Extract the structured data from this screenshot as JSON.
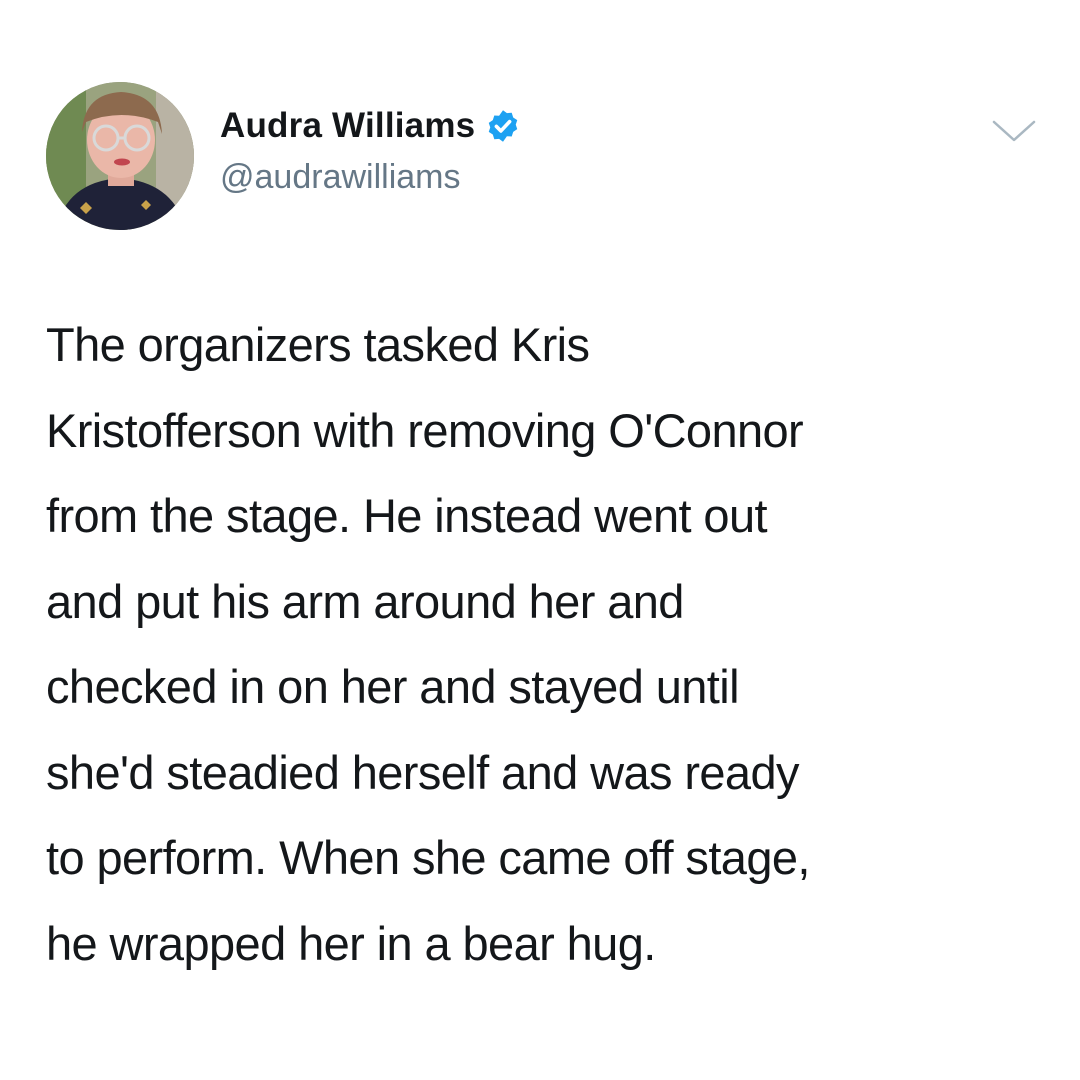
{
  "author": {
    "display_name": "Audra Williams",
    "handle": "@audrawilliams",
    "verified": true,
    "avatar": "avatar-photo"
  },
  "tweet": {
    "text": "The organizers tasked Kris\nKristofferson with removing O'Connor\nfrom the stage. He instead went out\nand put his arm around her and\nchecked in on her and stayed until\nshe'd steadied herself and was ready\nto perform. When she came off stage,\nhe wrapped her in a bear hug."
  },
  "icons": {
    "verified": "verified-badge-icon",
    "menu": "chevron-down-icon"
  },
  "colors": {
    "verified_blue": "#1da1f2",
    "text": "#14171a",
    "secondary_text": "#657786",
    "chevron": "#aab8c2"
  }
}
